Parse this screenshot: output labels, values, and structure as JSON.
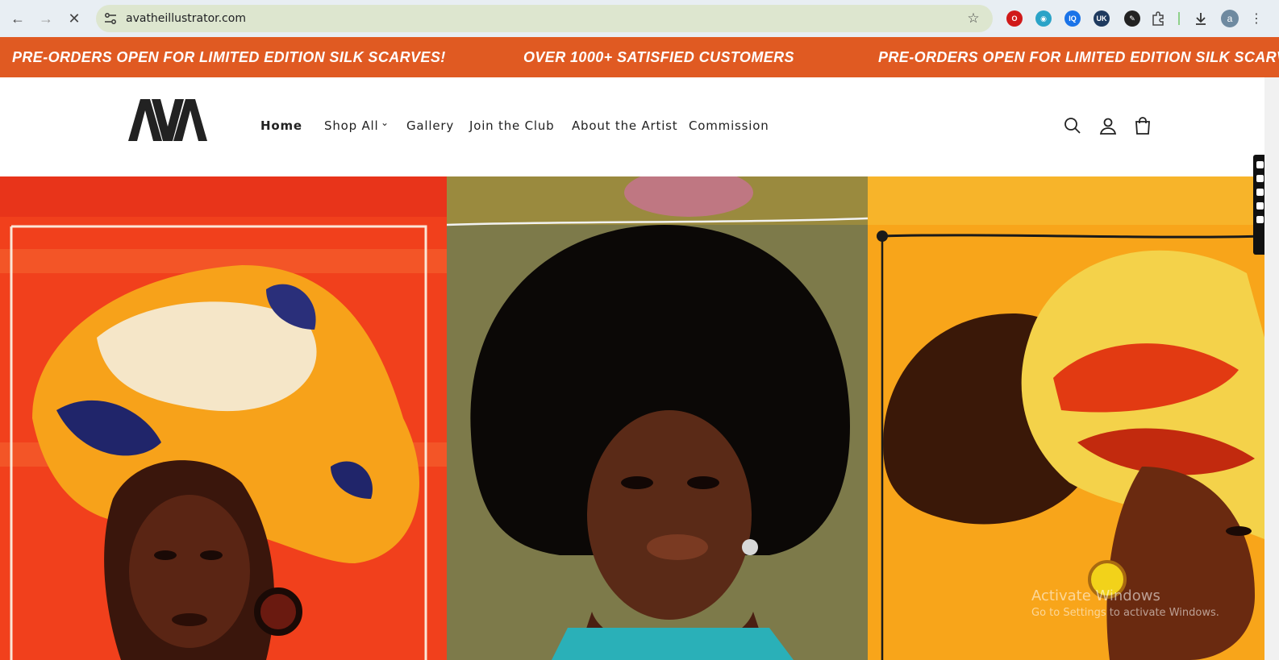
{
  "browser": {
    "url": "avatheillustrator.com",
    "icons": [
      "back-arrow-icon",
      "forward-arrow-icon",
      "stop-loading-icon",
      "site-settings-icon",
      "bookmark-star-icon",
      "extensions-puzzle-icon",
      "download-icon",
      "kebab-menu-icon"
    ],
    "extensions": [
      {
        "name": "opera-red-icon",
        "color": "#d01919"
      },
      {
        "name": "shield-ext-icon",
        "color": "#1a73e8"
      },
      {
        "name": "iq-ext-icon",
        "label": "IQ",
        "color": "#1a73e8"
      },
      {
        "name": "globe-uk-icon",
        "label": "UK",
        "color": "#1e3a5f"
      },
      {
        "name": "paint-ext-icon",
        "color": "#222222"
      }
    ],
    "profile_initial": "a"
  },
  "announcement": {
    "items": [
      "PRE-ORDERS OPEN FOR LIMITED EDITION SILK SCARVES!",
      "OVER 1000+ SATISFIED CUSTOMERS",
      "PRE-ORDERS OPEN FOR LIMITED EDITION SILK SCARVES!"
    ],
    "background": "#e05a22"
  },
  "header": {
    "logo_text": "AVA",
    "nav": [
      {
        "label": "Home",
        "active": true
      },
      {
        "label": "Shop All",
        "dropdown": true
      },
      {
        "label": "Gallery"
      },
      {
        "label": "Join the Club"
      },
      {
        "label": "About the Artist"
      },
      {
        "label": "Commission"
      }
    ],
    "actions": [
      "search-icon",
      "account-icon",
      "cart-icon"
    ]
  },
  "hero": {
    "panels": [
      {
        "name": "artwork-red-headwrap",
        "bg": "#f1401c"
      },
      {
        "name": "artwork-afro-portrait",
        "bg": "#7d7a4a"
      },
      {
        "name": "artwork-yellow-headwrap",
        "bg": "#f8a51a"
      }
    ]
  },
  "watermark": {
    "line1": "Activate Windows",
    "line2": "Go to Settings to activate Windows."
  }
}
